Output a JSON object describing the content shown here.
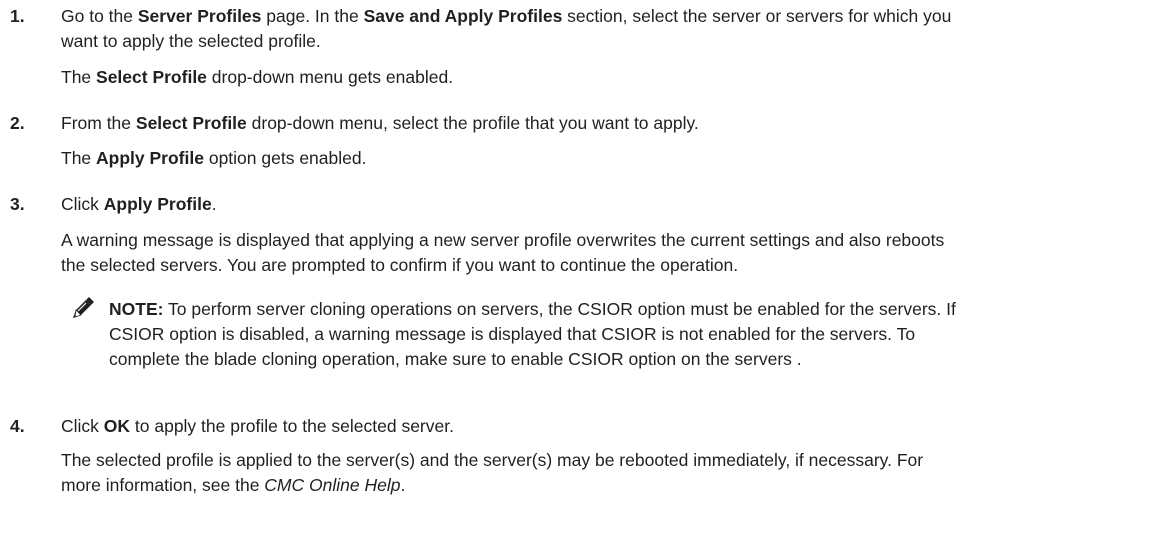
{
  "steps": [
    {
      "number": "1.",
      "lines": [
        [
          {
            "t": "Go to the "
          },
          {
            "t": "Server Profiles",
            "b": true
          },
          {
            "t": " page. In the "
          },
          {
            "t": "Save and Apply Profiles",
            "b": true
          },
          {
            "t": " section, select the server or servers for which you"
          }
        ],
        [
          {
            "t": "want to apply the selected profile."
          }
        ]
      ],
      "result": [
        {
          "t": "The "
        },
        {
          "t": "Select Profile",
          "b": true
        },
        {
          "t": " drop-down menu gets enabled."
        }
      ]
    },
    {
      "number": "2.",
      "lines": [
        [
          {
            "t": "From the "
          },
          {
            "t": "Select Profile",
            "b": true
          },
          {
            "t": " drop-down menu, select the profile that you want to apply."
          }
        ]
      ],
      "result": [
        {
          "t": "The "
        },
        {
          "t": "Apply Profile",
          "b": true
        },
        {
          "t": " option gets enabled."
        }
      ]
    },
    {
      "number": "3.",
      "lines": [
        [
          {
            "t": "Click "
          },
          {
            "t": "Apply Profile",
            "b": true
          },
          {
            "t": "."
          }
        ]
      ],
      "result_lines": [
        "A warning message is displayed that applying a new server profile overwrites the current settings and also reboots",
        "the selected servers. You are prompted to confirm if you want to continue the operation."
      ],
      "note": {
        "label": "NOTE:",
        "icon": "pencil-note-icon",
        "lines": [
          " To perform server cloning operations on servers, the CSIOR option must be enabled for the servers. If",
          "CSIOR option is disabled, a warning message is displayed that CSIOR is not enabled for the servers. To",
          "complete the blade cloning operation, make sure to enable CSIOR option on the servers ."
        ]
      }
    },
    {
      "number": "4.",
      "lines": [
        [
          {
            "t": "Click "
          },
          {
            "t": "OK",
            "b": true
          },
          {
            "t": " to apply the profile to the selected server."
          }
        ]
      ],
      "result_lines": [
        "The selected profile is applied to the server(s) and the server(s) may be rebooted immediately, if necessary. For"
      ],
      "result_tail": [
        {
          "t": "more information, see the "
        },
        {
          "t": "CMC Online Help",
          "i": true
        },
        {
          "t": "."
        }
      ]
    }
  ]
}
